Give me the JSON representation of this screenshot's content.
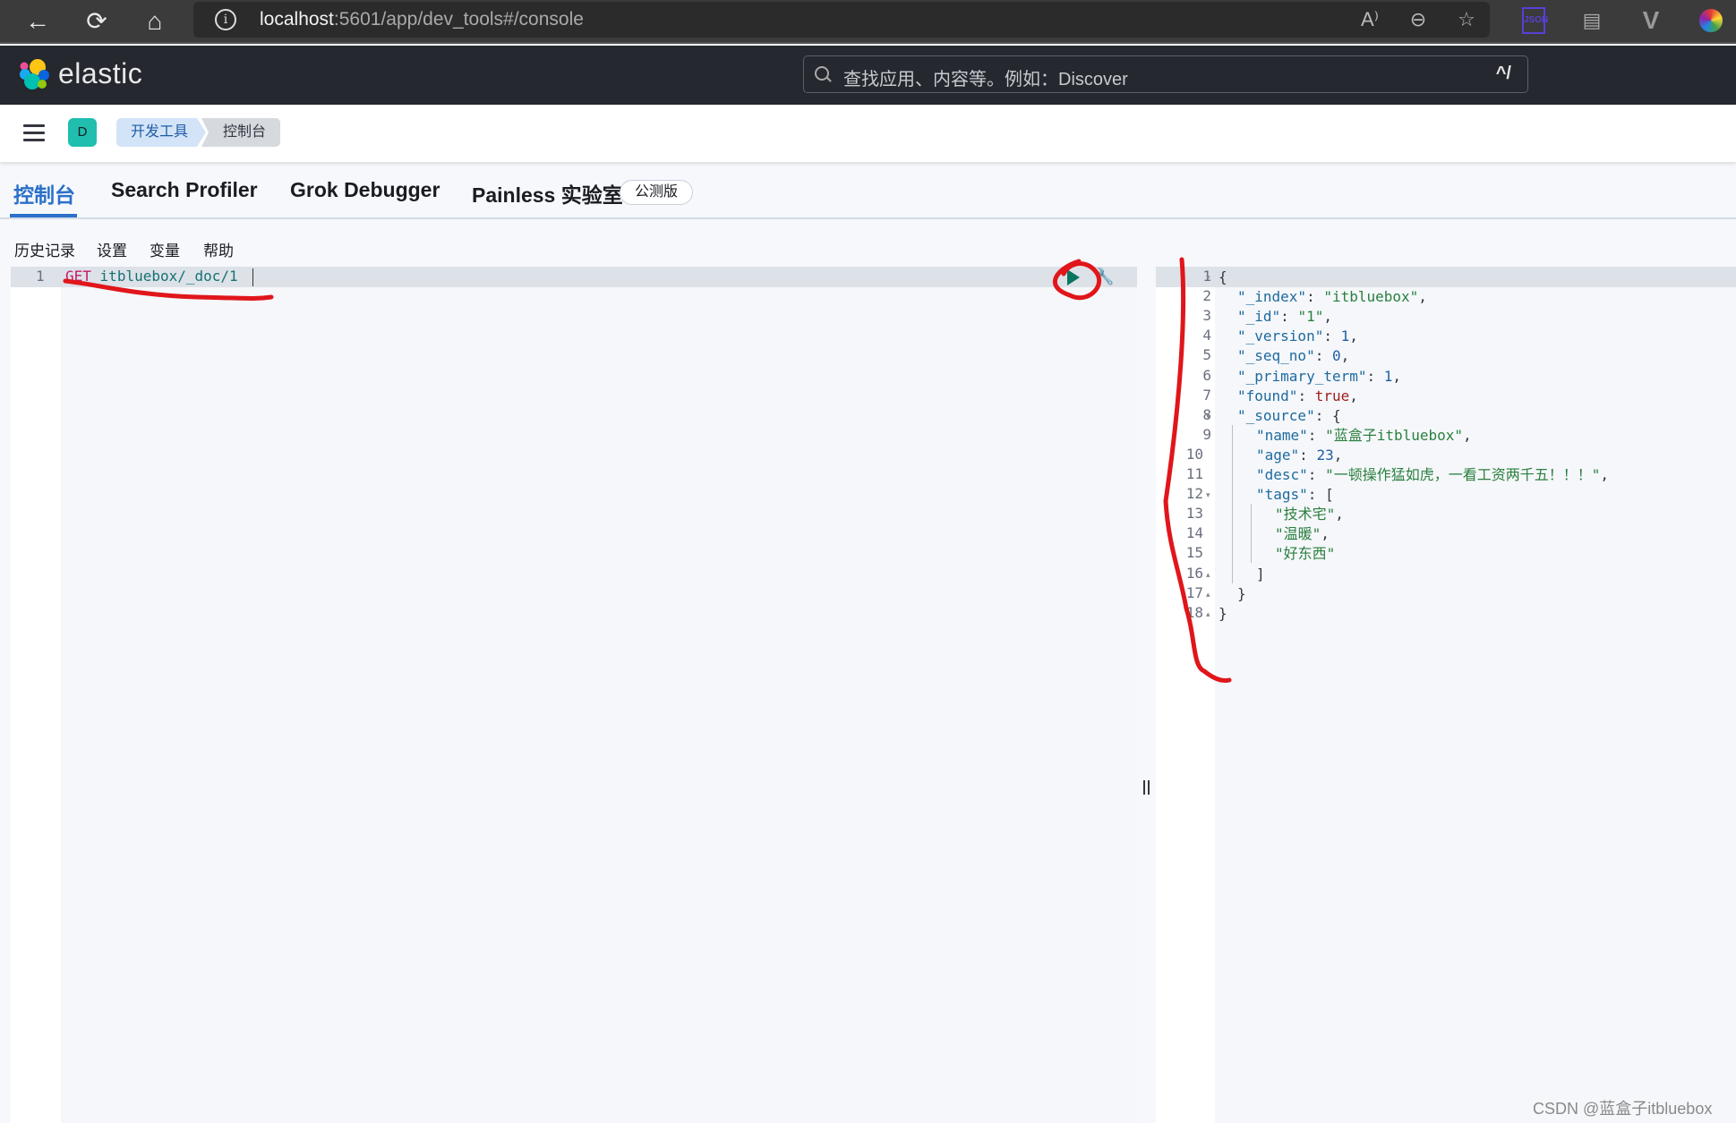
{
  "browser": {
    "back_icon": "←",
    "reload_icon": "⟳",
    "home_icon": "⌂",
    "url_host": "localhost",
    "url_rest": ":5601/app/dev_tools#/console",
    "read_aloud_icon": "A⁾",
    "zoom_out_icon": "⊖",
    "favorite_icon": "☆",
    "ext_json_label": "JSON",
    "ext_debug_icon": "▤",
    "ext_vue_icon": "V",
    "ext_color_icon": "●"
  },
  "header": {
    "logo_text": "elastic",
    "search_placeholder": "查找应用、内容等。例如：Discover",
    "search_shortcut": "^/"
  },
  "breadcrumbs": {
    "space_initial": "D",
    "items": [
      {
        "label": "开发工具"
      },
      {
        "label": "控制台"
      }
    ]
  },
  "tabs": [
    {
      "label": "控制台",
      "active": true
    },
    {
      "label": "Search Profiler",
      "active": false
    },
    {
      "label": "Grok Debugger",
      "active": false
    },
    {
      "label": "Painless 实验室",
      "active": false
    }
  ],
  "beta_badge": "公测版",
  "console_menu": [
    {
      "label": "历史记录"
    },
    {
      "label": "设置"
    },
    {
      "label": "变量"
    },
    {
      "label": "帮助"
    }
  ],
  "editor": {
    "lines": [
      {
        "number": "1",
        "method": "GET",
        "url": "itbluebox/_doc/1"
      }
    ]
  },
  "response": {
    "lines": [
      {
        "n": "1",
        "fold": "▾",
        "indent": 0,
        "parts": [
          [
            "p",
            "{"
          ]
        ]
      },
      {
        "n": "2",
        "fold": "",
        "indent": 1,
        "parts": [
          [
            "k",
            "\"_index\""
          ],
          [
            "p",
            ": "
          ],
          [
            "s",
            "\"itbluebox\""
          ],
          [
            "p",
            ","
          ]
        ]
      },
      {
        "n": "3",
        "fold": "",
        "indent": 1,
        "parts": [
          [
            "k",
            "\"_id\""
          ],
          [
            "p",
            ": "
          ],
          [
            "s",
            "\"1\""
          ],
          [
            "p",
            ","
          ]
        ]
      },
      {
        "n": "4",
        "fold": "",
        "indent": 1,
        "parts": [
          [
            "k",
            "\"_version\""
          ],
          [
            "p",
            ": "
          ],
          [
            "n",
            "1"
          ],
          [
            "p",
            ","
          ]
        ]
      },
      {
        "n": "5",
        "fold": "",
        "indent": 1,
        "parts": [
          [
            "k",
            "\"_seq_no\""
          ],
          [
            "p",
            ": "
          ],
          [
            "n",
            "0"
          ],
          [
            "p",
            ","
          ]
        ]
      },
      {
        "n": "6",
        "fold": "",
        "indent": 1,
        "parts": [
          [
            "k",
            "\"_primary_term\""
          ],
          [
            "p",
            ": "
          ],
          [
            "n",
            "1"
          ],
          [
            "p",
            ","
          ]
        ]
      },
      {
        "n": "7",
        "fold": "",
        "indent": 1,
        "parts": [
          [
            "k",
            "\"found\""
          ],
          [
            "p",
            ": "
          ],
          [
            "b",
            "true"
          ],
          [
            "p",
            ","
          ]
        ]
      },
      {
        "n": "8",
        "fold": "▾",
        "indent": 1,
        "parts": [
          [
            "k",
            "\"_source\""
          ],
          [
            "p",
            ": {"
          ]
        ]
      },
      {
        "n": "9",
        "fold": "",
        "indent": 2,
        "parts": [
          [
            "k",
            "\"name\""
          ],
          [
            "p",
            ": "
          ],
          [
            "s",
            "\"蓝盒子itbluebox\""
          ],
          [
            "p",
            ","
          ]
        ]
      },
      {
        "n": "10",
        "fold": "",
        "indent": 2,
        "parts": [
          [
            "k",
            "\"age\""
          ],
          [
            "p",
            ": "
          ],
          [
            "n",
            "23"
          ],
          [
            "p",
            ","
          ]
        ]
      },
      {
        "n": "11",
        "fold": "",
        "indent": 2,
        "parts": [
          [
            "k",
            "\"desc\""
          ],
          [
            "p",
            ": "
          ],
          [
            "s",
            "\"一顿操作猛如虎，一看工资两千五！！！\""
          ],
          [
            "p",
            ","
          ]
        ]
      },
      {
        "n": "12",
        "fold": "▾",
        "indent": 2,
        "parts": [
          [
            "k",
            "\"tags\""
          ],
          [
            "p",
            ": ["
          ]
        ]
      },
      {
        "n": "13",
        "fold": "",
        "indent": 3,
        "parts": [
          [
            "s",
            "\"技术宅\""
          ],
          [
            "p",
            ","
          ]
        ]
      },
      {
        "n": "14",
        "fold": "",
        "indent": 3,
        "parts": [
          [
            "s",
            "\"温暖\""
          ],
          [
            "p",
            ","
          ]
        ]
      },
      {
        "n": "15",
        "fold": "",
        "indent": 3,
        "parts": [
          [
            "s",
            "\"好东西\""
          ]
        ]
      },
      {
        "n": "16",
        "fold": "▴",
        "indent": 2,
        "parts": [
          [
            "p",
            "]"
          ]
        ]
      },
      {
        "n": "17",
        "fold": "▴",
        "indent": 1,
        "parts": [
          [
            "p",
            "}"
          ]
        ]
      },
      {
        "n": "18",
        "fold": "▴",
        "indent": 0,
        "parts": [
          [
            "p",
            "}"
          ]
        ]
      }
    ]
  },
  "watermark": "CSDN @蓝盒子itbluebox",
  "colors": {
    "accent": "#2b70c9",
    "annotation": "#e0161b",
    "run_button": "#087561"
  }
}
